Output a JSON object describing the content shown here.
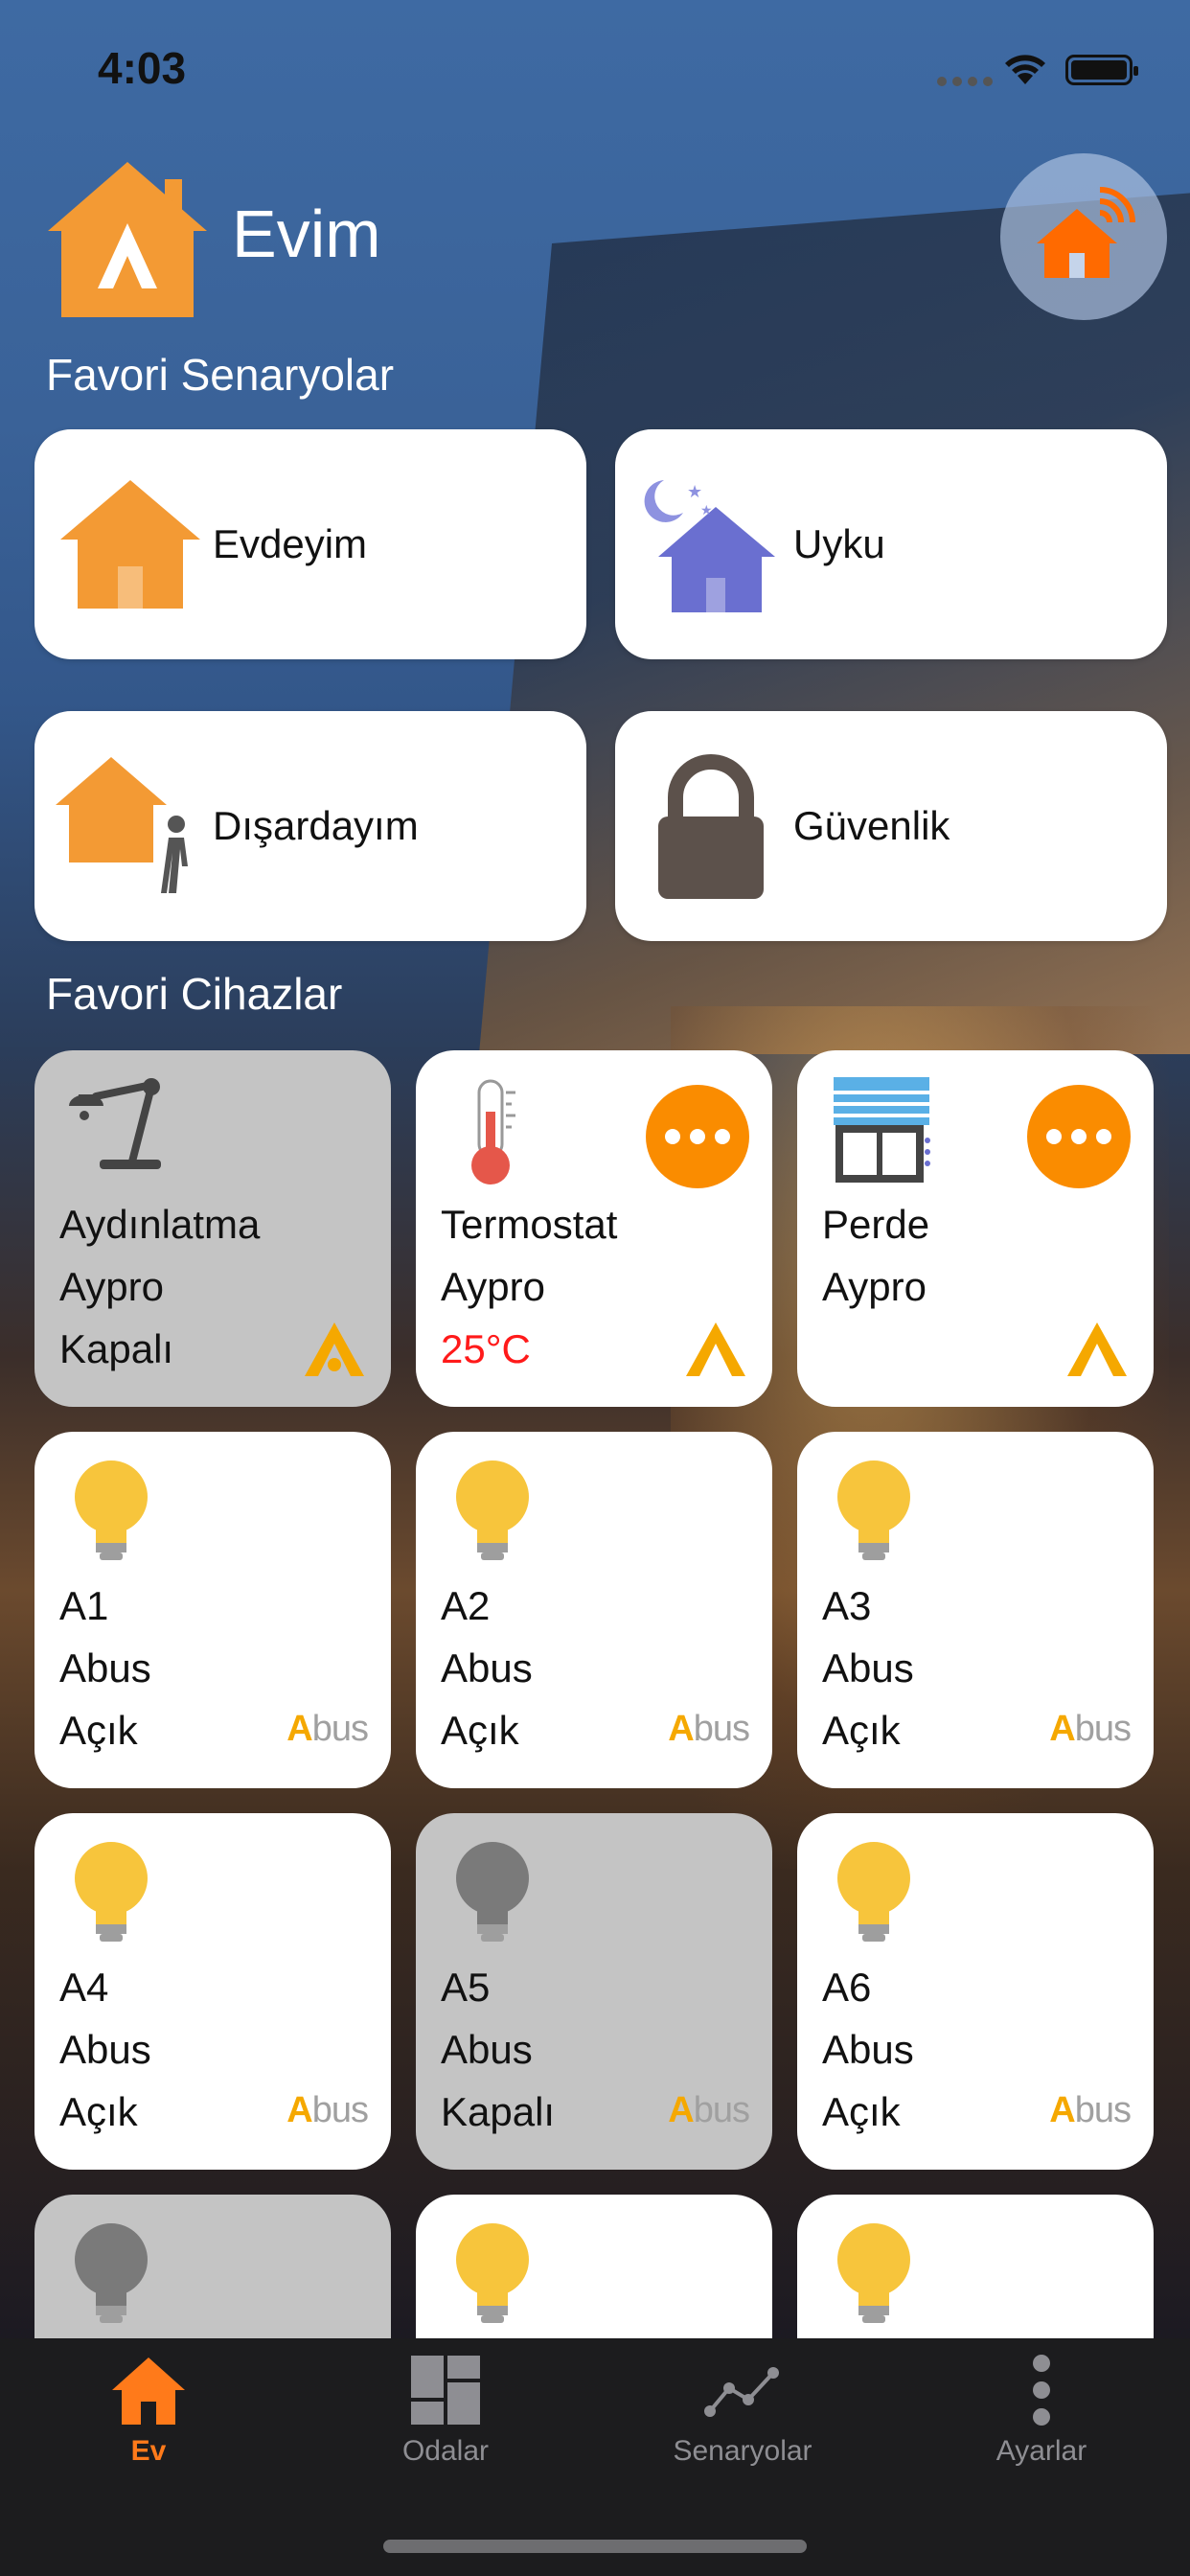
{
  "status": {
    "time": "4:03"
  },
  "header": {
    "title": "Evim"
  },
  "sections": {
    "scenarios": "Favori Senaryolar",
    "devices": "Favori Cihazlar"
  },
  "scenarios": [
    {
      "label": "Evdeyim",
      "icon": "home-icon"
    },
    {
      "label": "Uyku",
      "icon": "sleep-home-icon"
    },
    {
      "label": "Dışardayım",
      "icon": "away-home-icon"
    },
    {
      "label": "Güvenlik",
      "icon": "lock-icon"
    }
  ],
  "devices": [
    {
      "name": "Aydınlatma",
      "brand": "Aypro",
      "state": "Kapalı",
      "icon": "desk-lamp-icon",
      "on": false
    },
    {
      "name": "Termostat",
      "brand": "Aypro",
      "state": "25°C",
      "icon": "thermometer-icon",
      "on": true
    },
    {
      "name": "Perde",
      "brand": "Aypro",
      "state": "",
      "icon": "blinds-icon",
      "on": true
    },
    {
      "name": "A1",
      "brand": "Abus",
      "state": "Açık",
      "icon": "bulb-icon",
      "on": true
    },
    {
      "name": "A2",
      "brand": "Abus",
      "state": "Açık",
      "icon": "bulb-icon",
      "on": true
    },
    {
      "name": "A3",
      "brand": "Abus",
      "state": "Açık",
      "icon": "bulb-icon",
      "on": true
    },
    {
      "name": "A4",
      "brand": "Abus",
      "state": "Açık",
      "icon": "bulb-icon",
      "on": true
    },
    {
      "name": "A5",
      "brand": "Abus",
      "state": "Kapalı",
      "icon": "bulb-icon",
      "on": false
    },
    {
      "name": "A6",
      "brand": "Abus",
      "state": "Açık",
      "icon": "bulb-icon",
      "on": true
    }
  ],
  "abus_logo": {
    "a": "A",
    "rest": "bus"
  },
  "tabs": [
    {
      "label": "Ev",
      "icon": "home-icon",
      "active": true
    },
    {
      "label": "Odalar",
      "icon": "rooms-grid-icon",
      "active": false
    },
    {
      "label": "Senaryolar",
      "icon": "scenarios-chart-icon",
      "active": false
    },
    {
      "label": "Ayarlar",
      "icon": "more-vertical-icon",
      "active": false
    }
  ],
  "colors": {
    "accent": "#fa8c00",
    "tab_active": "#ff7a1a",
    "off_tile": "#c4c4c4",
    "temp": "#ff1a1a",
    "bulb_on": "#f7c53c",
    "bulb_off": "#7a7a7a"
  }
}
